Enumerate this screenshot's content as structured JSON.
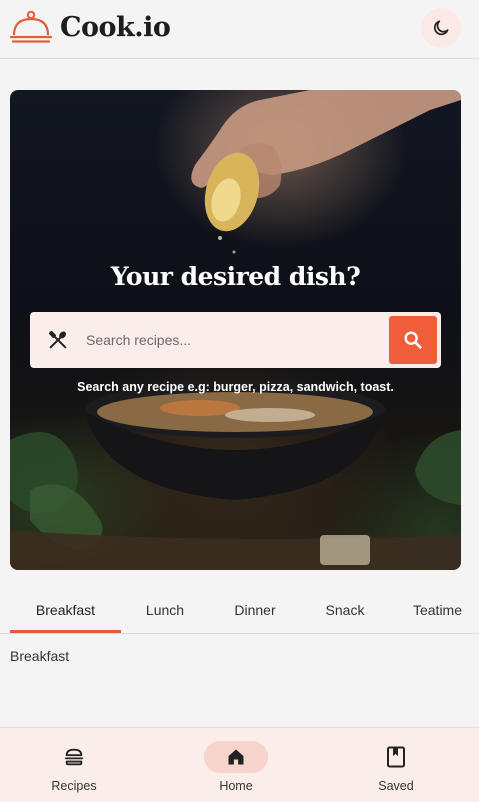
{
  "app": {
    "name": "Cook.io",
    "accent_color": "#f05d3a"
  },
  "header": {
    "logo_icon": "cloche-icon",
    "theme_toggle_icon": "moon-icon"
  },
  "hero": {
    "title": "Your desired dish?",
    "search": {
      "leading_icon": "utensils-icon",
      "placeholder": "Search recipes...",
      "value": "",
      "button_icon": "search-icon"
    },
    "hint": "Search any recipe e.g: burger, pizza, sandwich, toast."
  },
  "tabs": {
    "items": [
      {
        "label": "Breakfast",
        "active": true
      },
      {
        "label": "Lunch",
        "active": false
      },
      {
        "label": "Dinner",
        "active": false
      },
      {
        "label": "Snack",
        "active": false
      },
      {
        "label": "Teatime",
        "active": false
      }
    ],
    "panel_text": "Breakfast"
  },
  "bottom_nav": {
    "items": [
      {
        "label": "Recipes",
        "icon": "burger-icon",
        "active": false
      },
      {
        "label": "Home",
        "icon": "home-icon",
        "active": true
      },
      {
        "label": "Saved",
        "icon": "bookmark-icon",
        "active": false
      }
    ]
  }
}
